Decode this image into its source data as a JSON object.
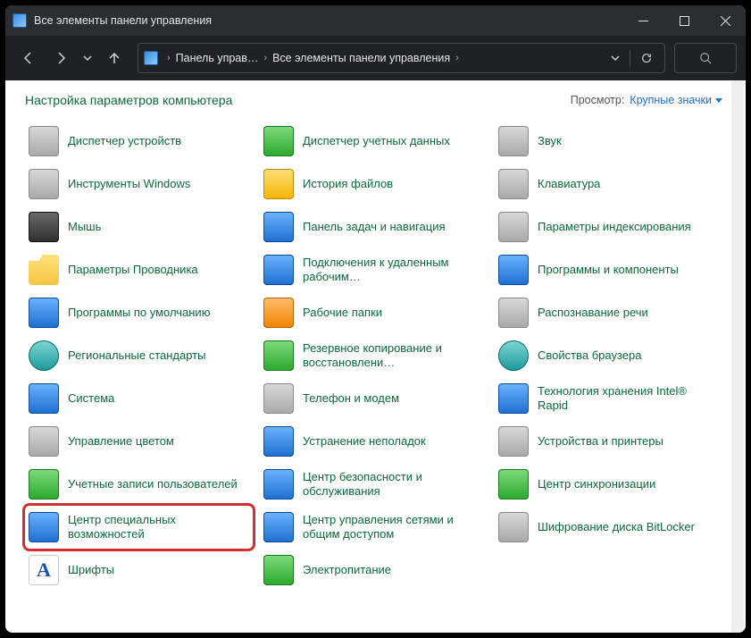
{
  "window": {
    "title": "Все элементы панели управления"
  },
  "breadcrumb": {
    "part1": "Панель управ…",
    "part2": "Все элементы панели управления"
  },
  "header": {
    "page_title": "Настройка параметров компьютера",
    "view_label": "Просмотр:",
    "view_value": "Крупные значки"
  },
  "items": [
    {
      "label": "Диспетчер устройств",
      "icon": "gray"
    },
    {
      "label": "Диспетчер учетных данных",
      "icon": "green"
    },
    {
      "label": "Звук",
      "icon": "gray"
    },
    {
      "label": "Инструменты Windows",
      "icon": "gray"
    },
    {
      "label": "История файлов",
      "icon": "yellow"
    },
    {
      "label": "Клавиатура",
      "icon": "gray"
    },
    {
      "label": "Мышь",
      "icon": "dark"
    },
    {
      "label": "Панель задач и навигация",
      "icon": "blue"
    },
    {
      "label": "Параметры индексирования",
      "icon": "gray"
    },
    {
      "label": "Параметры Проводника",
      "icon": "folder"
    },
    {
      "label": "Подключения к удаленным рабочим…",
      "icon": "blue"
    },
    {
      "label": "Программы и компоненты",
      "icon": "blue"
    },
    {
      "label": "Программы по умолчанию",
      "icon": "blue"
    },
    {
      "label": "Рабочие папки",
      "icon": "orange"
    },
    {
      "label": "Распознавание речи",
      "icon": "gray"
    },
    {
      "label": "Региональные стандарты",
      "icon": "teal"
    },
    {
      "label": "Резервное копирование и восстановлени…",
      "icon": "green"
    },
    {
      "label": "Свойства браузера",
      "icon": "teal"
    },
    {
      "label": "Система",
      "icon": "blue"
    },
    {
      "label": "Телефон и модем",
      "icon": "gray"
    },
    {
      "label": "Технология хранения Intel® Rapid",
      "icon": "blue"
    },
    {
      "label": "Управление цветом",
      "icon": "gray"
    },
    {
      "label": "Устранение неполадок",
      "icon": "blue"
    },
    {
      "label": "Устройства и принтеры",
      "icon": "gray"
    },
    {
      "label": "Учетные записи пользователей",
      "icon": "green"
    },
    {
      "label": "Центр безопасности и обслуживания",
      "icon": "blue"
    },
    {
      "label": "Центр синхронизации",
      "icon": "green"
    },
    {
      "label": "Центр специальных возможностей",
      "icon": "blue",
      "highlighted": true
    },
    {
      "label": "Центр управления сетями и общим доступом",
      "icon": "blue"
    },
    {
      "label": "Шифрование диска BitLocker",
      "icon": "gray"
    },
    {
      "label": "Шрифты",
      "icon": "letter-A"
    },
    {
      "label": "Электропитание",
      "icon": "green"
    }
  ]
}
